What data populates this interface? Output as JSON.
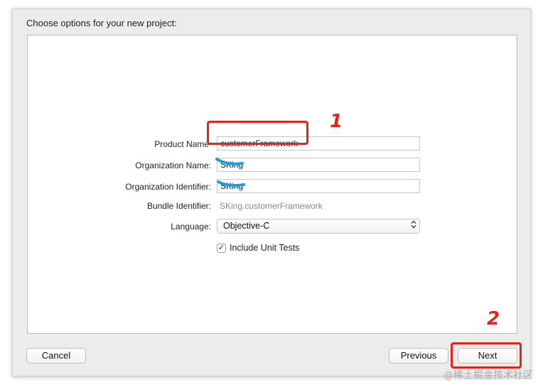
{
  "dialog": {
    "title": "Choose options for your new project:",
    "fields": {
      "product_name": {
        "label": "Product Name",
        "value": "customerFramework"
      },
      "organization_name": {
        "label": "Organization Name:",
        "value": "SKing"
      },
      "organization_identifier": {
        "label": "Organization Identifier:",
        "value": "SKing"
      },
      "bundle_identifier": {
        "label": "Bundle Identifier:",
        "value": "SKing.customerFramework"
      },
      "language": {
        "label": "Language:",
        "value": "Objective-C"
      }
    },
    "include_unit_tests": {
      "label": "Include Unit Tests",
      "checked": true,
      "mark": "✓"
    },
    "buttons": {
      "cancel": "Cancel",
      "previous": "Previous",
      "next": "Next"
    }
  },
  "annotations": {
    "step1": "1",
    "step2": "2",
    "color": "#e0251b",
    "scribble_color": "#1a9fe0"
  },
  "watermark": "@稀土掘金技术社区"
}
